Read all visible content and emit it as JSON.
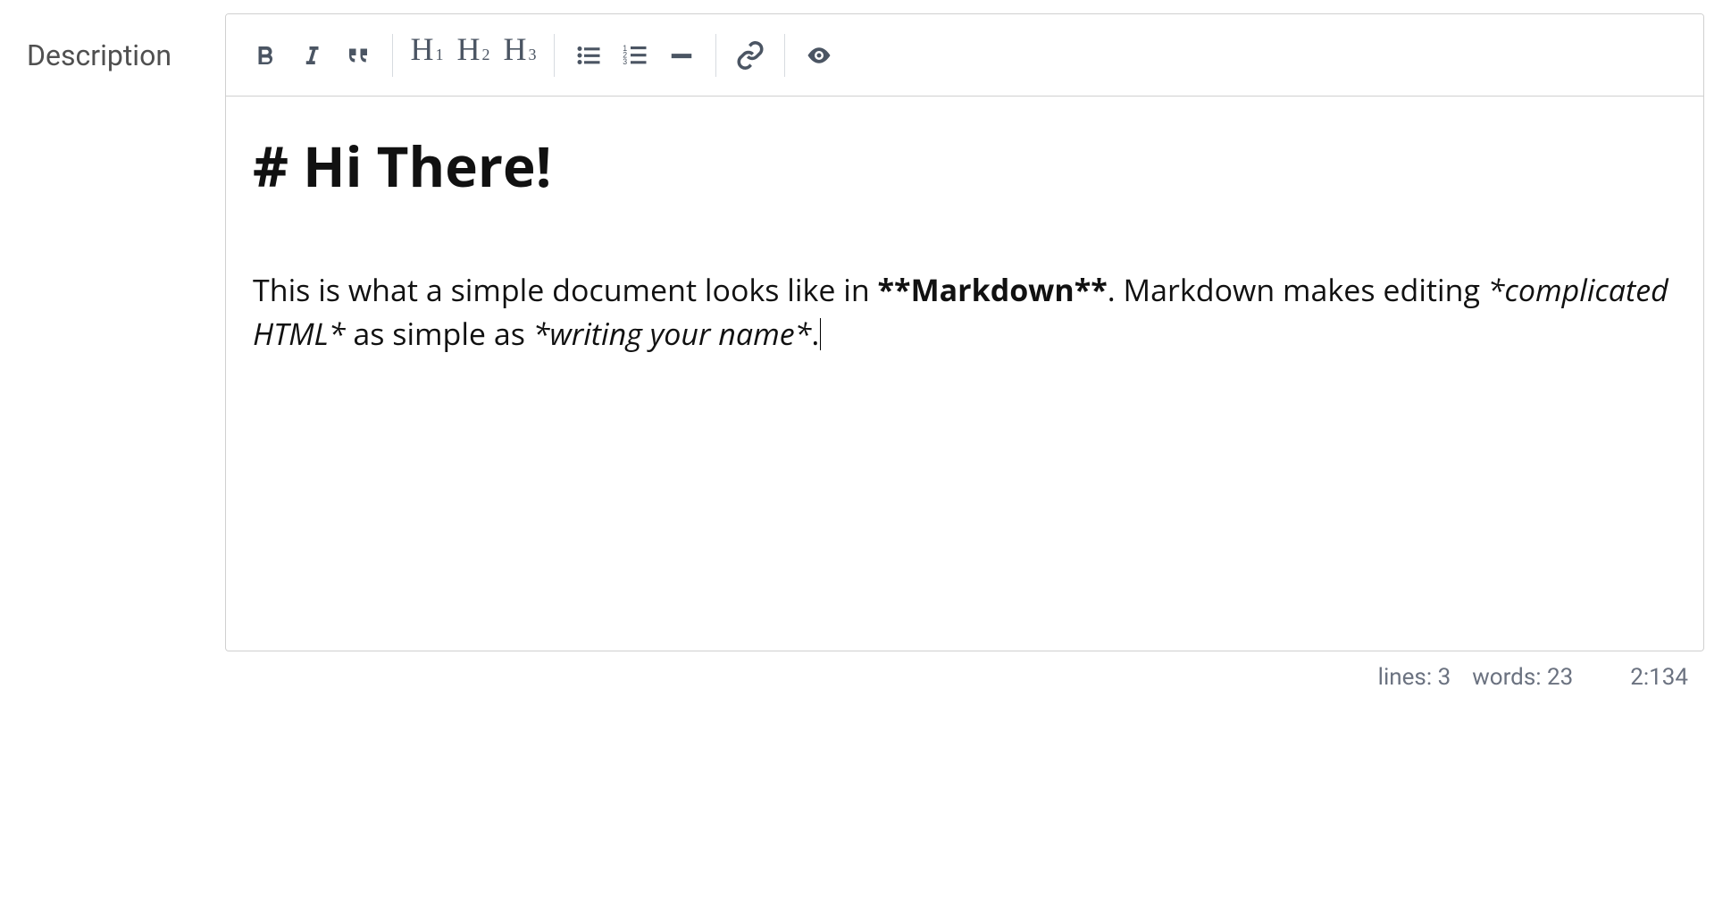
{
  "field_label": "Description",
  "toolbar": {
    "bold_icon": "bold-icon",
    "italic_icon": "italic-icon",
    "quote_icon": "quote-icon",
    "h1_label": "H",
    "h1_sub": "1",
    "h2_label": "H",
    "h2_sub": "2",
    "h3_label": "H",
    "h3_sub": "3",
    "ul_icon": "unordered-list-icon",
    "ol_icon": "ordered-list-icon",
    "hr_icon": "horizontal-rule-icon",
    "link_icon": "link-icon",
    "preview_icon": "preview-icon"
  },
  "content": {
    "heading": "# Hi There!",
    "para_1": "This is what a simple document looks like in ",
    "bold_1": "**Markdown**",
    "para_2": ". Markdown makes editing ",
    "italic_1": "*complicated HTML*",
    "para_3": " as simple as ",
    "italic_2": "*writing your name*",
    "para_4": "."
  },
  "status": {
    "lines_label": "lines:",
    "lines_value": "3",
    "words_label": "words:",
    "words_value": "23",
    "cursor_position": "2:134"
  }
}
